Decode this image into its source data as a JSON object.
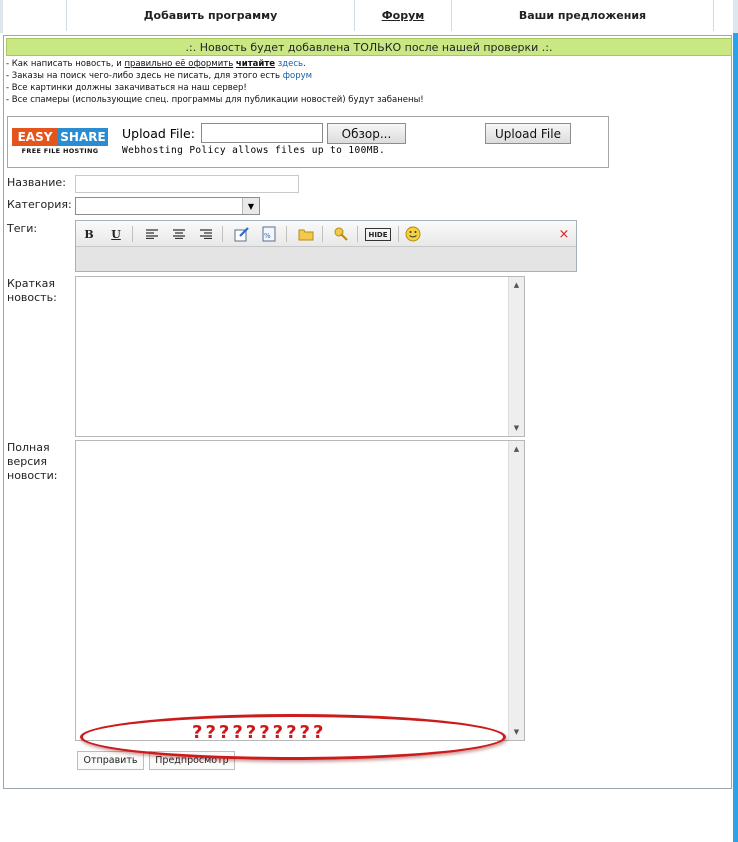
{
  "nav": {
    "items": [
      "Добавить программу",
      "Форум",
      "Ваши предложения"
    ]
  },
  "banner": ".:. Новость будет добавлена ТОЛЬКО после нашей проверки .:.",
  "rules": {
    "line1_a": "- Как написать новость, и ",
    "line1_b": "правильно её оформить",
    "line1_c": " ",
    "line1_d": "читайте",
    "line1_e": " ",
    "line1_f": "здесь",
    "line1_g": ".",
    "line2_a": "- Заказы на поиск чего-либо здесь не писать, для этого есть ",
    "line2_b": "форум",
    "line3": "- Все картинки должны закачиваться на наш сервер!",
    "line4": "- Все спамеры (использующие спец. программы для публикации новостей) будут забанены!"
  },
  "upload": {
    "logo_easy": "EASY",
    "logo_share": "SHARE",
    "logo_sub": "FREE FILE HOSTING",
    "label": "Upload File:",
    "browse": "Обзор...",
    "upload_button": "Upload File",
    "note": "Webhosting Policy allows files up to 100MB."
  },
  "form": {
    "title_label": "Название:",
    "category_label": "Категория:",
    "tags_label": "Теги:",
    "short_label_1": "Краткая",
    "short_label_2": "новость:",
    "full_label_1": "Полная",
    "full_label_2": "версия",
    "full_label_3": "новости:",
    "submit": "Отправить",
    "preview": "Предпросмотр"
  },
  "toolbar": {
    "bold": "B",
    "underline": "U",
    "hide": "HIDE",
    "close": "×"
  },
  "annotation": {
    "text": "??????????",
    "color": "#cc1b1b"
  },
  "colors": {
    "banner_bg": "#c9e884",
    "accent_strip": "#2aa4e8",
    "link": "#1660a8"
  }
}
